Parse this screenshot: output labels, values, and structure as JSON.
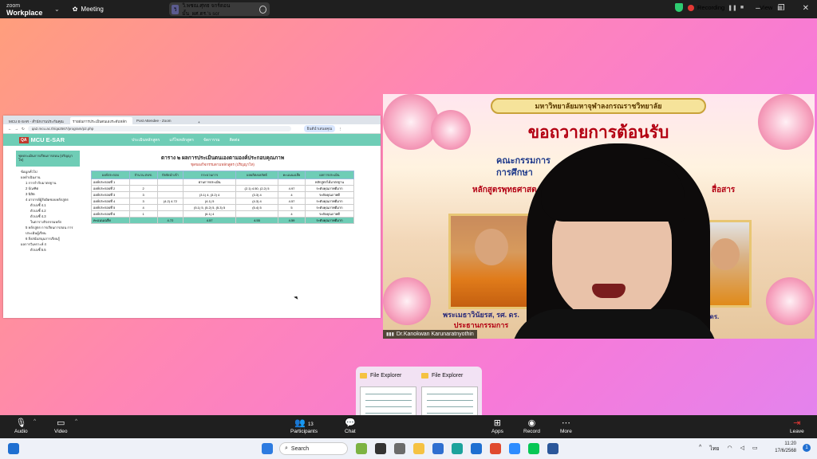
{
  "topbar": {
    "app_line1": "zoom",
    "app_line2": "Workplace",
    "meeting_label": "Meeting",
    "share_badge": "วิ",
    "share_label": "วิ.พชณ.ศุทธ จกร์ดอนมั้น_ผศ.ดร.'s scr",
    "recording_label": "Recording",
    "view_label": "View"
  },
  "browser": {
    "tabs": [
      "MCU E-SAR - สำนักงานประกันคุณ",
      "รายผ่นการประเมินตนเองระดับหลัก",
      "Post Attendee - Zoom"
    ],
    "url": "qa2.mcu.ac.th/qa2567/program/p2.php",
    "profile": "ยินดีนำเสนอคุณ",
    "site_logo_box": "QA",
    "site_logo": "MCU E-SAR",
    "nav": [
      "ประเมินหลักสูตร",
      "แก้ไขหลักสูตร",
      "จัดการรม",
      "ติดต่อ"
    ],
    "side_head": "ชุดประเมินการเรียนการสอน (ปริญญาโท)",
    "side_items": [
      {
        "text": "ข้อมูลทั่วไป",
        "level": 0
      },
      {
        "text": "ผลดำเนินงาน",
        "level": 0
      },
      {
        "text": "1 การกำกับมาตรฐาน",
        "level": 1
      },
      {
        "text": "2 บัณฑิต",
        "level": 1
      },
      {
        "text": "3 นิสิต",
        "level": 1
      },
      {
        "text": "4 อาจารย์ผู้รับผิดชอบหลักสูตร",
        "level": 1
      },
      {
        "text": "ตัวบ่งชี้ 4.1",
        "level": 2
      },
      {
        "text": "ตัวบ่งชี้ 4.2",
        "level": 2
      },
      {
        "text": "ตัวบ่งชี้ 4.3",
        "level": 2
      },
      {
        "text": "ในตารางกิจกรรมหลัก",
        "level": 2
      },
      {
        "text": "5 หลักสูตร การเรียนการสอน การประเมินผู้เรียน",
        "level": 1
      },
      {
        "text": "6 สิ่งสนับสนุนการเรียนรู้",
        "level": 1
      },
      {
        "text": "ผลการวิเคราะห์ 4",
        "level": 0
      },
      {
        "text": "ตัวบ่งชี้ 5.5",
        "level": 2
      }
    ],
    "table_title": "ตาราง ๒ ผลการประเมินตนเองตามองค์ประกอบคุณภาพ",
    "table_subtitle": "ชุดของกิจกรรมตามหลักสูตร (ปริญญาโท)",
    "headers": [
      "องค์ประกอบ",
      "จำนวน ตบช.",
      "ปัจจัยนำเข้า",
      "กระบวนการ",
      "ผลผลิต/ผลลัพธ์",
      "คะแนนเฉลี่ย",
      "ผลการประเมิน"
    ],
    "rows": [
      [
        "องค์ประกอบที่ 1",
        "",
        "",
        "ผ่านการประเมิน",
        "",
        "",
        "หลักสูตรได้มาตรฐาน"
      ],
      [
        "องค์ประกอบที่ 2",
        "2",
        "",
        "",
        "(2.1) 4.50, (2.2) 5",
        "4.97",
        "ระดับคุณภาพดีมาก"
      ],
      [
        "องค์ประกอบที่ 3",
        "3",
        "",
        "(3.1) 4, (3.2) 4",
        "(3.3) 4",
        "4",
        "ระดับคุณภาพดี"
      ],
      [
        "องค์ประกอบที่ 4",
        "3",
        "(4.2) 4.72",
        "(4.1) 5",
        "(4.3) 4",
        "4.57",
        "ระดับคุณภาพดีมาก"
      ],
      [
        "องค์ประกอบที่ 5",
        "4",
        "",
        "(5.1) 5, (5.2) 5, (5.3) 5",
        "(5.4) 5",
        "5",
        "ระดับคุณภาพดีมาก"
      ],
      [
        "องค์ประกอบที่ 6",
        "1",
        "",
        "(6.1) 4",
        "",
        "4",
        "ระดับคุณภาพดี"
      ]
    ],
    "summary": [
      "คะแนนเฉลี่ย",
      "",
      "4.72",
      "4.57",
      "4.55",
      "4.59",
      "ระดับคุณภาพดีมาก"
    ]
  },
  "video": {
    "banner": "มหาวิทยาลัยมหาจุฬาลงกรณราชวิทยาลัย",
    "welcome": "ขอถวายการต้อนรับ",
    "faculty_line1": "คณะกรรมการ",
    "faculty_line2": "การศึกษา",
    "program_left": "หลักสูตรพุทธศาสต",
    "program_right": "สื่อสาร",
    "caption_name": "พระเมธาวินัยรส, รศ. ดร.",
    "caption_role": "ประธานกรรมการ",
    "caption2": "ศ. ดร.",
    "participant_name": "Dr.Kanokwan Karunaratnyothin"
  },
  "file_explorer": [
    {
      "label": "File Explorer"
    },
    {
      "label": "File Explorer"
    }
  ],
  "controls": {
    "audio": "Audio",
    "video": "Video",
    "participants": "Participants",
    "participants_count": "13",
    "chat": "Chat",
    "apps": "Apps",
    "record": "Record",
    "more": "More",
    "leave": "Leave"
  },
  "taskbar": {
    "search": "Search",
    "lang": "ไทย",
    "time": "11:20",
    "date": "17/6/2568",
    "notification": "1"
  },
  "colors": {
    "site_green": "#6fcdb6",
    "record_red": "#e53935",
    "leave_red": "#e53935",
    "zoom_bar": "#1f1f1f"
  }
}
